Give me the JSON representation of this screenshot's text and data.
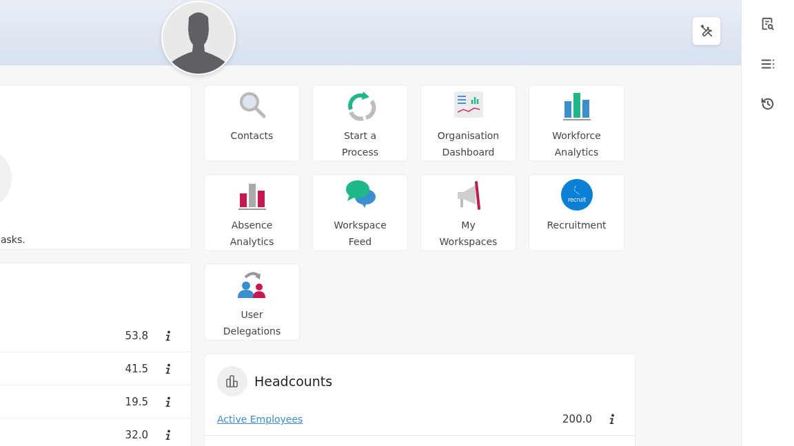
{
  "tasks_card": {
    "text": "asks."
  },
  "metrics_card": {
    "rows": [
      {
        "value": "53.8"
      },
      {
        "value": "41.5"
      },
      {
        "value": "19.5"
      },
      {
        "value": "32.0"
      }
    ]
  },
  "tiles": [
    {
      "label": "Contacts",
      "kind": "search"
    },
    {
      "label": "Start a\nProcess",
      "kind": "process"
    },
    {
      "label": "Organisation\nDashboard",
      "kind": "dashboard"
    },
    {
      "label": "Workforce\nAnalytics",
      "kind": "workforce"
    },
    {
      "label": "Absence\nAnalytics",
      "kind": "absence"
    },
    {
      "label": "Workspace\nFeed",
      "kind": "chat"
    },
    {
      "label": "My\nWorkspaces",
      "kind": "megaphone"
    },
    {
      "label": "Recruitment",
      "kind": "recruit",
      "logo_text": "recruit"
    },
    {
      "label": "User\nDelegations",
      "kind": "delegation"
    }
  ],
  "headcounts": {
    "title": "Headcounts",
    "rows": [
      {
        "label": "Active Employees",
        "value": "200.0"
      }
    ]
  }
}
